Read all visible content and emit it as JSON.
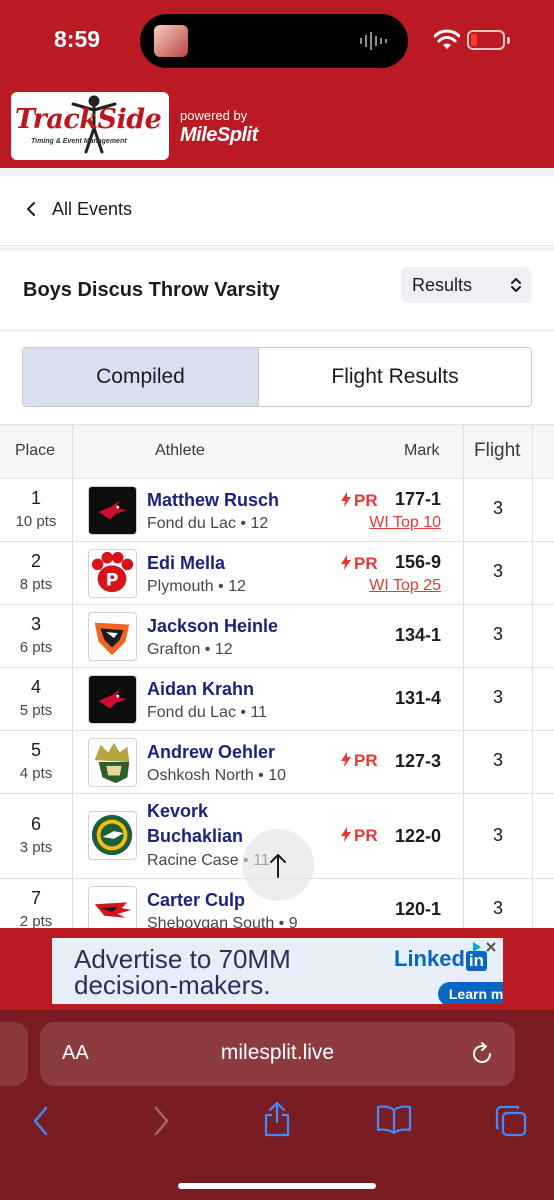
{
  "status_bar": {
    "time": "8:59"
  },
  "header": {
    "logo_text": "TrackSide",
    "logo_subtext": "Timing & Event Management",
    "powered_by": "powered by",
    "brand": "MileSplit"
  },
  "nav": {
    "back_label": "All Events"
  },
  "event": {
    "title": "Boys Discus Throw Varsity",
    "view_select": "Results"
  },
  "tabs": [
    {
      "label": "Compiled"
    },
    {
      "label": "Flight Results"
    }
  ],
  "table": {
    "headers": {
      "place": "Place",
      "athlete": "Athlete",
      "mark": "Mark",
      "flight": "Flight"
    },
    "rows": [
      {
        "place": "1",
        "points": "10 pts",
        "name": "Matthew Rusch",
        "school": "Fond du Lac • 12",
        "pr": "PR",
        "mark": "177-1",
        "rank": "WI Top 10",
        "flight": "3"
      },
      {
        "place": "2",
        "points": "8 pts",
        "name": "Edi Mella",
        "school": "Plymouth • 12",
        "pr": "PR",
        "mark": "156-9",
        "rank": "WI Top 25",
        "flight": "3"
      },
      {
        "place": "3",
        "points": "6 pts",
        "name": "Jackson Heinle",
        "school": "Grafton • 12",
        "pr": "",
        "mark": "134-1",
        "rank": "",
        "flight": "3"
      },
      {
        "place": "4",
        "points": "5 pts",
        "name": "Aidan Krahn",
        "school": "Fond du Lac • 11",
        "pr": "",
        "mark": "131-4",
        "rank": "",
        "flight": "3"
      },
      {
        "place": "5",
        "points": "4 pts",
        "name": "Andrew Oehler",
        "school": "Oshkosh North • 10",
        "pr": "PR",
        "mark": "127-3",
        "rank": "",
        "flight": "3"
      },
      {
        "place": "6",
        "points": "3 pts",
        "name_line1": "Kevork",
        "name_line2": "Buchaklian",
        "school": "Racine Case • 11",
        "pr": "PR",
        "mark": "122-0",
        "rank": "",
        "flight": "3"
      },
      {
        "place": "7",
        "points": "2 pts",
        "name": "Carter Culp",
        "school": "Sheboygan South • 9",
        "pr": "",
        "mark": "120-1",
        "rank": "",
        "flight": "3"
      }
    ]
  },
  "ad": {
    "headline": "Advertise to 70MM decision-makers.",
    "brand": "Linked",
    "brand_box": "in",
    "cta": "Learn more"
  },
  "browser": {
    "aa": "AA",
    "url": "milesplit.live"
  },
  "colors": {
    "brand_red": "#bb1a22",
    "name_navy": "#1a237e",
    "pr_red": "#e53935",
    "browser_bar": "#7a1d22"
  }
}
